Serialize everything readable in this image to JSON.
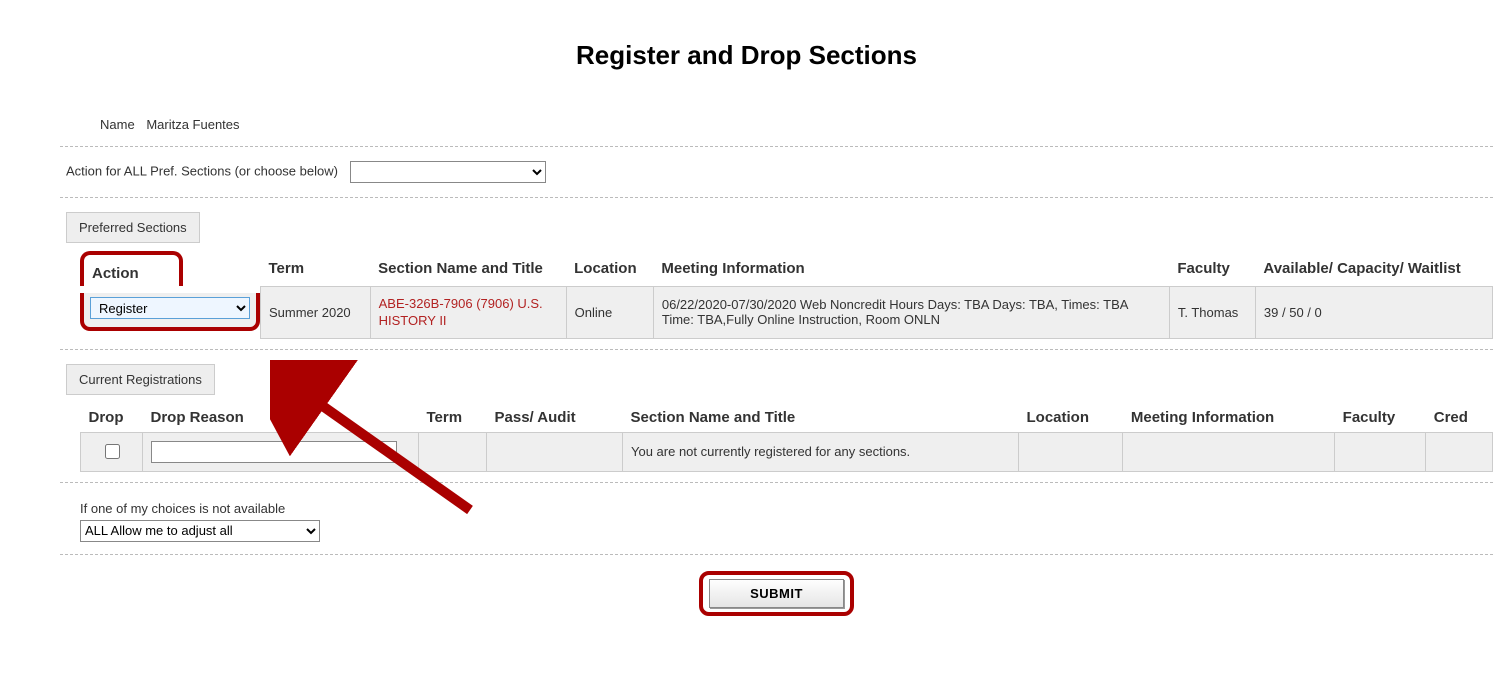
{
  "page_title": "Register and Drop Sections",
  "name_label": "Name",
  "user_name": "Maritza Fuentes",
  "all_action_label": "Action for ALL Pref. Sections (or choose below)",
  "preferred_sections_btn": "Preferred Sections",
  "pref_headers": {
    "action": "Action",
    "term": "Term",
    "section": "Section Name and Title",
    "location": "Location",
    "meeting": "Meeting Information",
    "faculty": "Faculty",
    "avail": "Available/ Capacity/ Waitlist"
  },
  "pref_row": {
    "action_value": "Register",
    "term": "Summer 2020",
    "section_link": "ABE-326B-7906 (7906) U.S. HISTORY II",
    "location": "Online",
    "meeting": "06/22/2020-07/30/2020 Web Noncredit Hours Days: TBA Days: TBA, Times: TBA Time: TBA,Fully Online Instruction, Room ONLN",
    "faculty": "T. Thomas",
    "avail": "39 / 50 / 0"
  },
  "current_reg_btn": "Current Registrations",
  "cur_headers": {
    "drop": "Drop",
    "reason": "Drop Reason",
    "term": "Term",
    "pass": "Pass/ Audit",
    "section": "Section Name and Title",
    "location": "Location",
    "meeting": "Meeting Information",
    "faculty": "Faculty",
    "cred": "Cred"
  },
  "no_reg_msg": "You are not currently registered for any sections.",
  "avail_label": "If one of my choices is not available",
  "avail_option": "ALL Allow me to adjust all",
  "submit_label": "SUBMIT"
}
